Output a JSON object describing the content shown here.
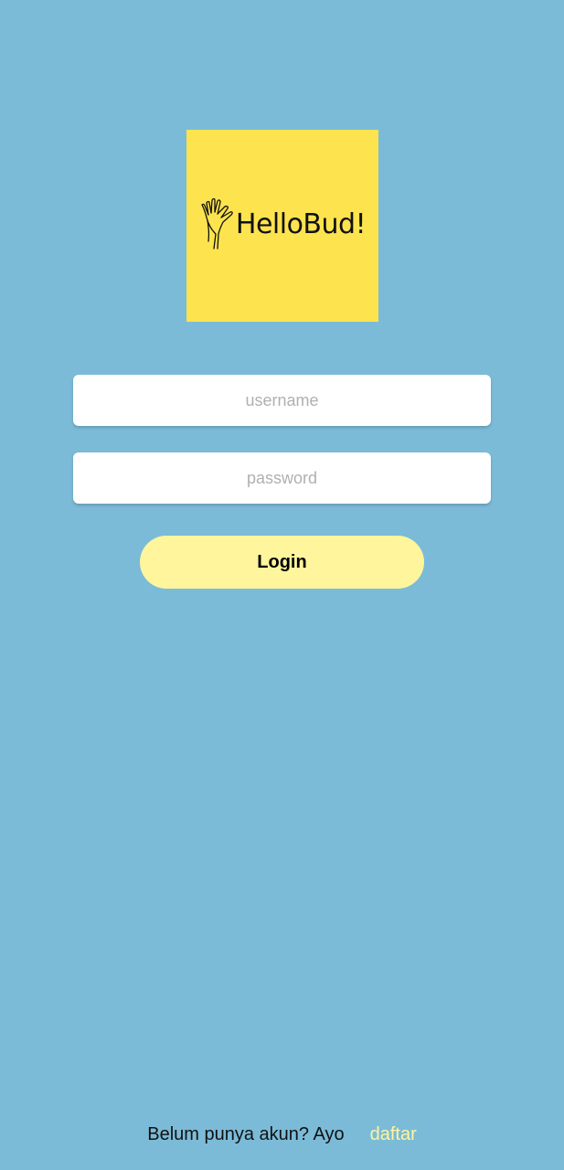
{
  "logo": {
    "brand_text": "HelloBud!",
    "icon": "waving-hand-icon",
    "background_color": "#fde44e"
  },
  "form": {
    "username_placeholder": "username",
    "password_placeholder": "password",
    "login_label": "Login"
  },
  "footer": {
    "prompt_text": "Belum punya akun? Ayo",
    "register_link": "daftar"
  },
  "colors": {
    "background": "#7bbbd8",
    "button": "#fff59d",
    "link": "#fff59d"
  }
}
